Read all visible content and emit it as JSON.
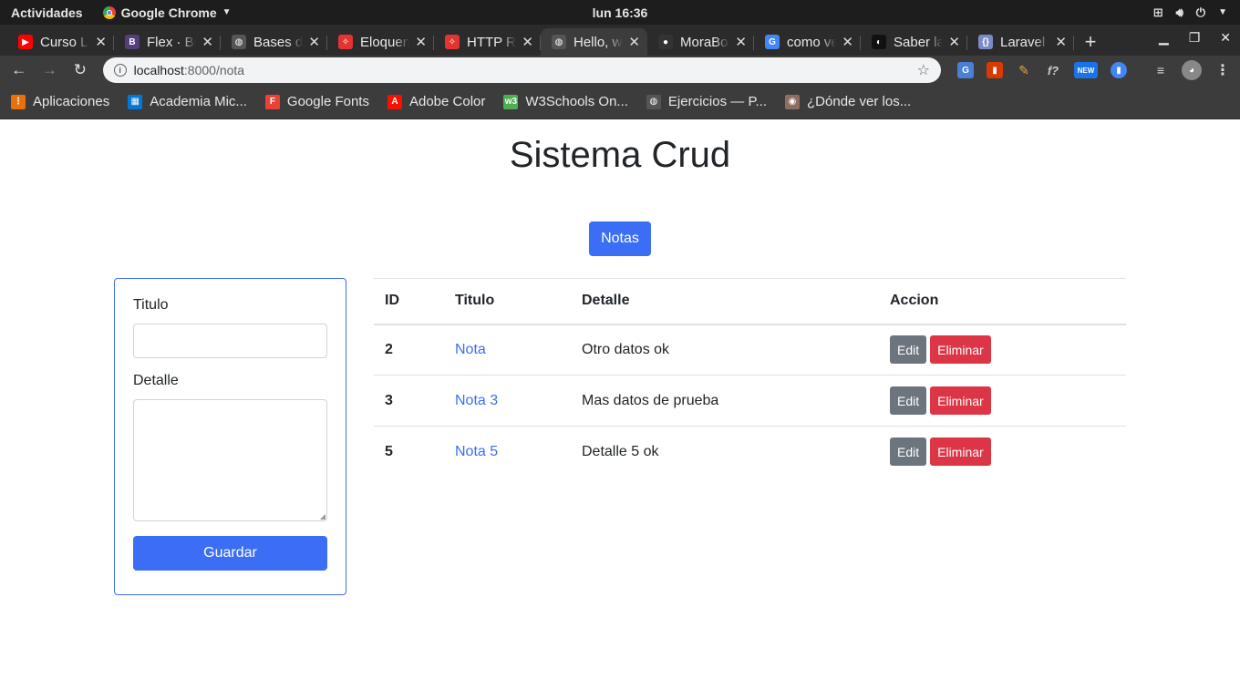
{
  "system": {
    "activities": "Actividades",
    "app_name": "Google Chrome",
    "clock": "lun 16:36"
  },
  "tabs": [
    {
      "title": "Curso L",
      "favicon_color": "#ff0000",
      "favicon_glyph": "▶"
    },
    {
      "title": "Flex · Bo",
      "favicon_color": "#563d7c",
      "favicon_glyph": "B"
    },
    {
      "title": "Bases d",
      "favicon_color": "#555555",
      "favicon_glyph": "◍"
    },
    {
      "title": "Eloquen",
      "favicon_color": "#e3342f",
      "favicon_glyph": "✧"
    },
    {
      "title": "HTTP Re",
      "favicon_color": "#e3342f",
      "favicon_glyph": "✧"
    },
    {
      "title": "Hello, w",
      "favicon_color": "#555555",
      "favicon_glyph": "◍"
    },
    {
      "title": "MoraBo",
      "favicon_color": "#333333",
      "favicon_glyph": "●"
    },
    {
      "title": "como ve",
      "favicon_color": "#4285f4",
      "favicon_glyph": "G"
    },
    {
      "title": "Saber la",
      "favicon_color": "#111111",
      "favicon_glyph": "◐"
    },
    {
      "title": "Laravel",
      "favicon_color": "#7a8bc6",
      "favicon_glyph": "{}"
    }
  ],
  "active_tab_index": 5,
  "address": {
    "host": "localhost",
    "path": ":8000/nota"
  },
  "bookmarks": [
    {
      "label": "Aplicaciones",
      "icon_color": "#e8710a",
      "glyph": "⋮"
    },
    {
      "label": "Academia Mic...",
      "icon_color": "#0078d4",
      "glyph": "▦"
    },
    {
      "label": "Google Fonts",
      "icon_color": "#ea4335",
      "glyph": "F"
    },
    {
      "label": "Adobe Color",
      "icon_color": "#fa0f00",
      "glyph": "A"
    },
    {
      "label": "W3Schools On...",
      "icon_color": "#4caf50",
      "glyph": "w3"
    },
    {
      "label": "Ejercicios — P...",
      "icon_color": "#555555",
      "glyph": "◍"
    },
    {
      "label": "¿Dónde ver los...",
      "icon_color": "#8d6e63",
      "glyph": "◉"
    }
  ],
  "page": {
    "title": "Sistema Crud",
    "notas_button": "Notas",
    "form": {
      "titulo_label": "Titulo",
      "detalle_label": "Detalle",
      "titulo_value": "",
      "detalle_value": "",
      "submit_label": "Guardar"
    },
    "table": {
      "headers": [
        "ID",
        "Titulo",
        "Detalle",
        "Accion"
      ],
      "rows": [
        {
          "id": "2",
          "titulo": "Nota",
          "detalle": "Otro datos ok"
        },
        {
          "id": "3",
          "titulo": "Nota 3",
          "detalle": "Mas datos de prueba"
        },
        {
          "id": "5",
          "titulo": "Nota 5",
          "detalle": "Detalle 5 ok"
        }
      ],
      "edit_label": "Edit",
      "delete_label": "Eliminar"
    }
  },
  "colors": {
    "primary": "#3c6ef5",
    "danger": "#dc3545",
    "secondary": "#6c757d"
  }
}
